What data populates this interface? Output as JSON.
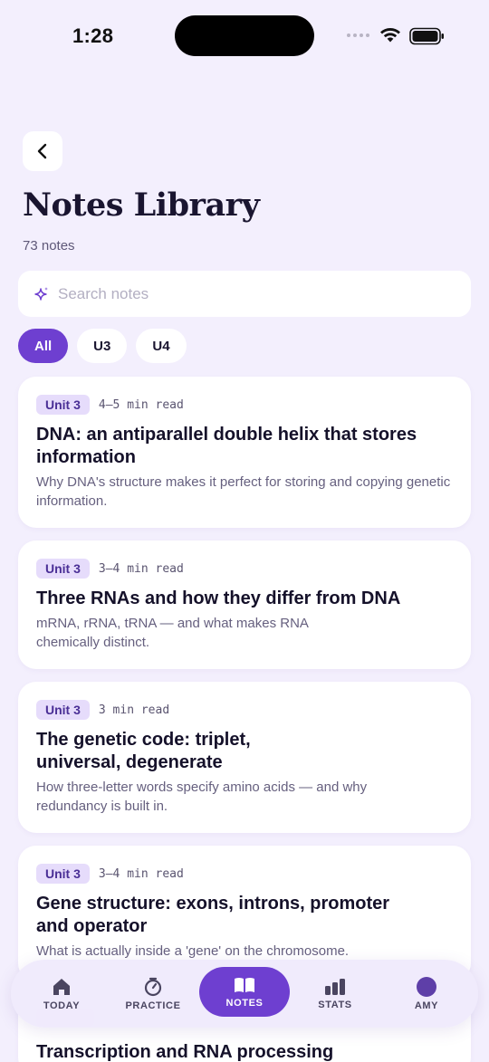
{
  "status": {
    "time": "1:28"
  },
  "header": {
    "title": "Notes Library",
    "count": "73 notes"
  },
  "search": {
    "placeholder": "Search notes"
  },
  "filters": [
    {
      "label": "All",
      "active": true
    },
    {
      "label": "U3",
      "active": false
    },
    {
      "label": "U4",
      "active": false
    }
  ],
  "notes": [
    {
      "unit": "Unit 3",
      "read": "4–5 min read",
      "title": "DNA: an antiparallel double helix that stores information",
      "desc": "Why DNA's structure makes it perfect for storing and copying genetic information."
    },
    {
      "unit": "Unit 3",
      "read": "3–4 min read",
      "title": "Three RNAs and how they differ from DNA",
      "desc": "mRNA, rRNA, tRNA — and what makes RNA chemically distinct."
    },
    {
      "unit": "Unit 3",
      "read": "3 min read",
      "title": "The genetic code: triplet, universal, degenerate",
      "desc": "How three-letter words specify amino acids — and why redundancy is built in."
    },
    {
      "unit": "Unit 3",
      "read": "3–4 min read",
      "title": "Gene structure: exons, introns, promoter and operator",
      "desc": "What is actually inside a 'gene' on the chromosome."
    },
    {
      "unit": "",
      "read": "",
      "title": "Transcription and RNA processing",
      "desc": ""
    }
  ],
  "tabs": [
    {
      "label": "TODAY",
      "icon": "home-icon"
    },
    {
      "label": "PRACTICE",
      "icon": "timer-icon"
    },
    {
      "label": "NOTES",
      "icon": "book-icon",
      "active": true
    },
    {
      "label": "STATS",
      "icon": "bar-chart-icon"
    },
    {
      "label": "AMY",
      "icon": "avatar-icon"
    }
  ],
  "colors": {
    "accent": "#6e3fd0",
    "background": "#f3effd",
    "badge": "#e6dcfb"
  }
}
